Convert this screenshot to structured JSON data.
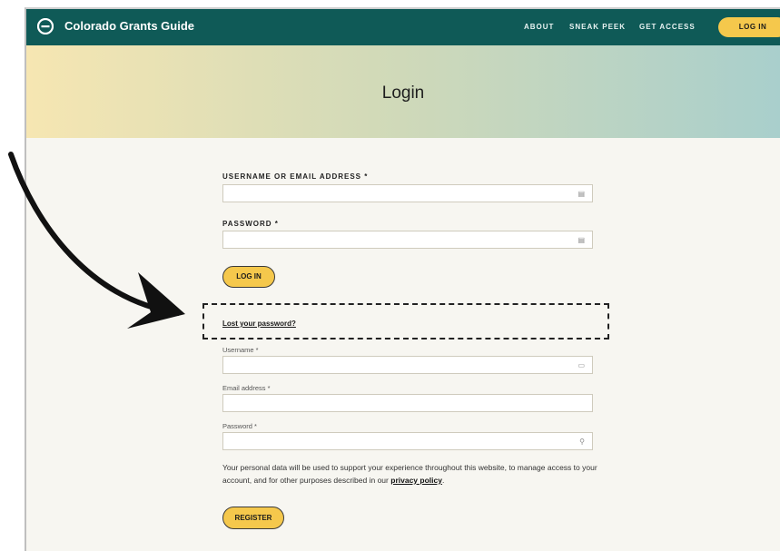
{
  "brand": {
    "name": "Colorado Grants Guide",
    "logo_icon": "circle-e-logo-icon"
  },
  "nav": {
    "about": "ABOUT",
    "sneak_peek": "SNEAK PEEK",
    "get_access": "GET ACCESS",
    "login_button": "LOG IN"
  },
  "hero": {
    "title": "Login"
  },
  "login_form": {
    "username_label": "USERNAME OR EMAIL ADDRESS *",
    "password_label": "PASSWORD *",
    "submit_label": "LOG IN",
    "field_icon": "keyboard-icon"
  },
  "lost_password": {
    "link": "Lost your password?"
  },
  "register_form": {
    "username_label": "Username *",
    "email_label": "Email address *",
    "password_label": "Password *",
    "privacy_text": "Your personal data will be used to support your experience throughout this website, to manage access to your account, and for other purposes described in our",
    "privacy_link": "privacy policy",
    "privacy_end": ".",
    "submit_label": "REGISTER"
  },
  "colors": {
    "topbar": "#0f5a57",
    "accent": "#f5c84c",
    "page_bg": "#f7f6f1"
  }
}
